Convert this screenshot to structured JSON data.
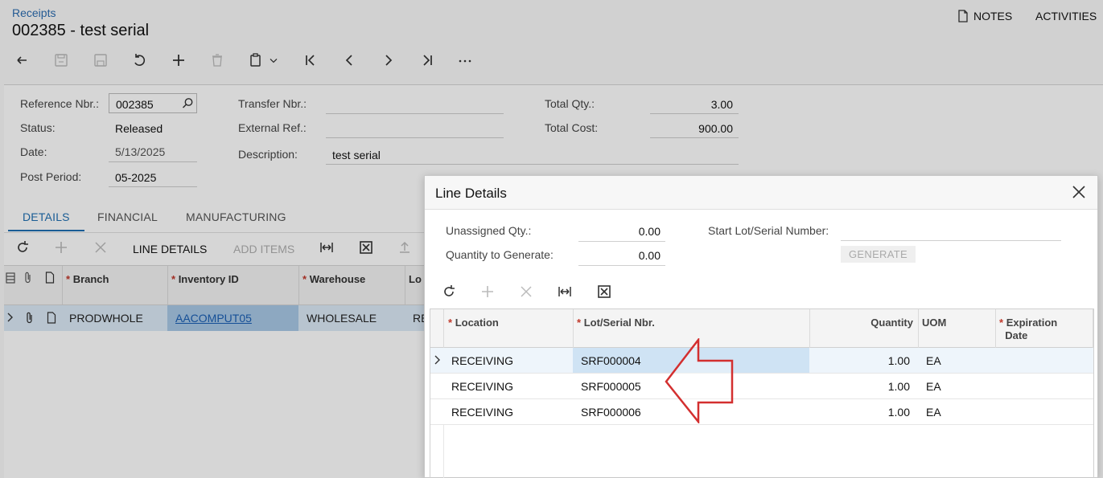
{
  "header": {
    "breadcrumb": "Receipts",
    "title": "002385 - test serial",
    "notes_label": "NOTES",
    "activities_label": "ACTIVITIES"
  },
  "toolbar": {
    "icons": [
      "undo-back-icon",
      "save-close-icon",
      "save-icon",
      "revert-icon",
      "add-icon",
      "delete-icon",
      "clipboard-icon",
      "first-icon",
      "prev-icon",
      "next-icon",
      "last-icon",
      "more-icon"
    ]
  },
  "form": {
    "reference_nbr_label": "Reference Nbr.:",
    "reference_nbr_value": "002385",
    "status_label": "Status:",
    "status_value": "Released",
    "date_label": "Date:",
    "date_value": "5/13/2025",
    "post_period_label": "Post Period:",
    "post_period_value": "05-2025",
    "transfer_nbr_label": "Transfer Nbr.:",
    "transfer_nbr_value": "",
    "external_ref_label": "External Ref.:",
    "external_ref_value": "",
    "description_label": "Description:",
    "description_value": "test serial",
    "total_qty_label": "Total Qty.:",
    "total_qty_value": "3.00",
    "total_cost_label": "Total Cost:",
    "total_cost_value": "900.00"
  },
  "tabs": [
    "DETAILS",
    "FINANCIAL",
    "MANUFACTURING"
  ],
  "details_toolbar": {
    "line_details": "LINE DETAILS",
    "add_items": "ADD ITEMS"
  },
  "details_grid": {
    "columns": [
      "Branch",
      "Inventory ID",
      "Warehouse",
      "Lo"
    ],
    "row": {
      "branch": "PRODWHOLE",
      "inventory_id": "AACOMPUT05",
      "warehouse": "WHOLESALE",
      "location_partial": "RE"
    }
  },
  "dialog": {
    "title": "Line Details",
    "unassigned_qty_label": "Unassigned Qty.:",
    "unassigned_qty_value": "0.00",
    "qty_to_generate_label": "Quantity to Generate:",
    "qty_to_generate_value": "0.00",
    "start_lot_label": "Start Lot/Serial Number:",
    "start_lot_value": "",
    "generate_label": "GENERATE",
    "columns": {
      "location": "Location",
      "lot_serial": "Lot/Serial Nbr.",
      "quantity": "Quantity",
      "uom": "UOM",
      "expiration_1": "Expiration",
      "expiration_2": "Date"
    },
    "rows": [
      {
        "location": "RECEIVING",
        "lot_serial": "SRF000004",
        "quantity": "1.00",
        "uom": "EA",
        "expiration": ""
      },
      {
        "location": "RECEIVING",
        "lot_serial": "SRF000005",
        "quantity": "1.00",
        "uom": "EA",
        "expiration": ""
      },
      {
        "location": "RECEIVING",
        "lot_serial": "SRF000006",
        "quantity": "1.00",
        "uom": "EA",
        "expiration": ""
      }
    ]
  },
  "colors": {
    "link": "#2b6cb0",
    "tab_active": "#1f6fb2",
    "required": "#c0392b",
    "selected_row": "#dceaf7",
    "annotation_arrow": "#d32f2f"
  }
}
